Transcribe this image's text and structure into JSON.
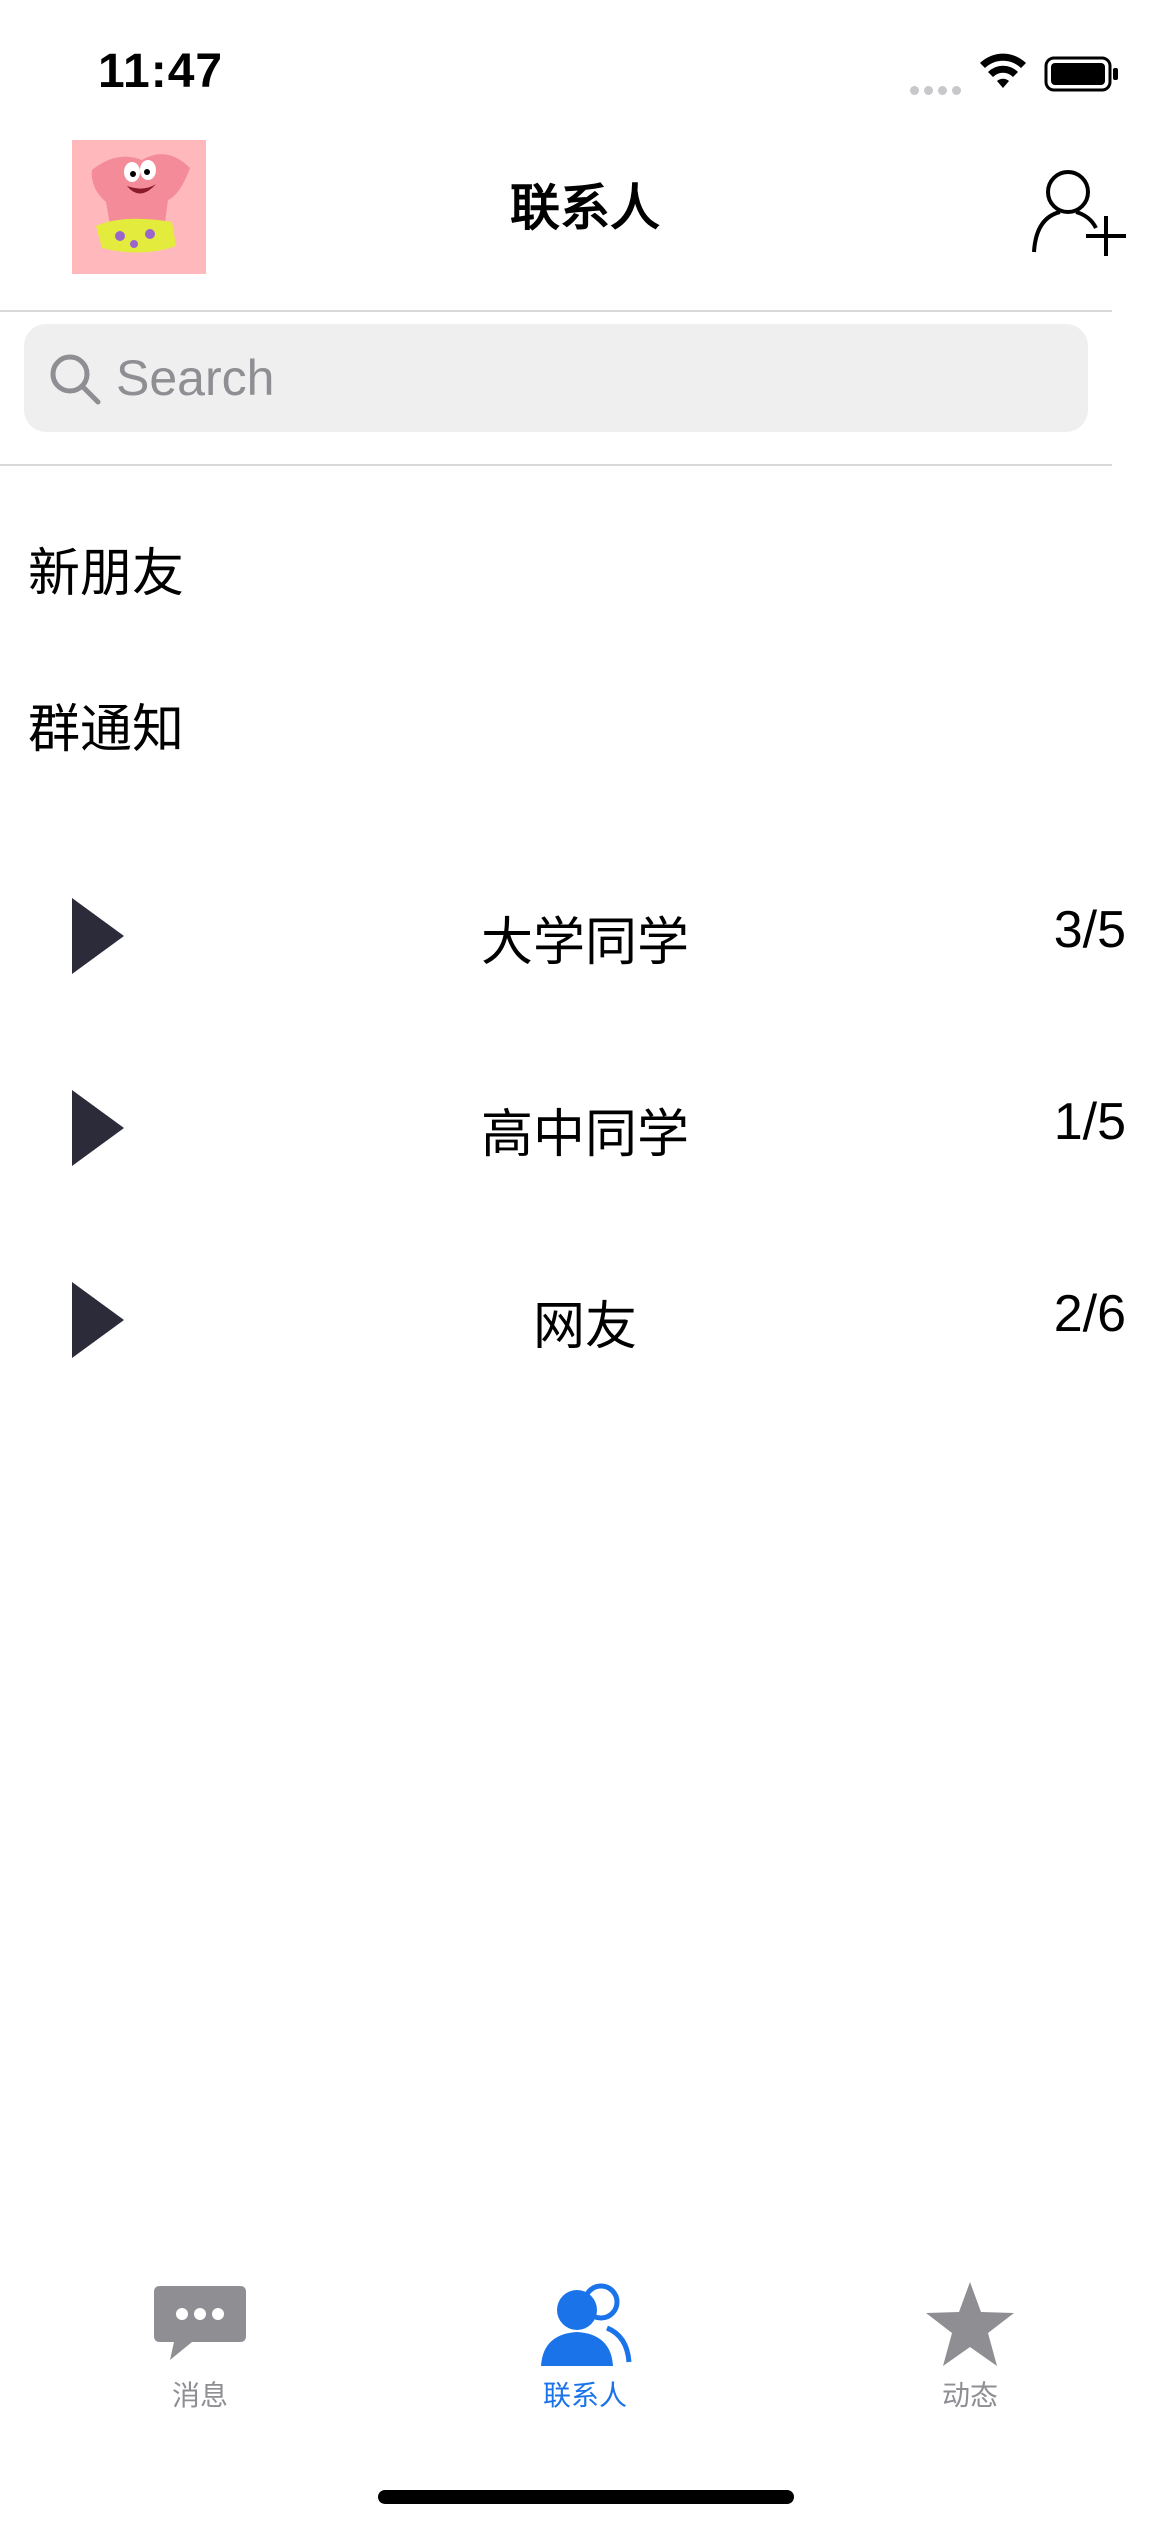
{
  "status_bar": {
    "time": "11:47"
  },
  "nav": {
    "title": "联系人"
  },
  "search": {
    "placeholder": "Search"
  },
  "menu": {
    "new_friends": "新朋友",
    "group_notice": "群通知"
  },
  "groups": [
    {
      "name": "大学同学",
      "count": "3/5"
    },
    {
      "name": "高中同学",
      "count": "1/5"
    },
    {
      "name": "网友",
      "count": "2/6"
    }
  ],
  "tabs": [
    {
      "label": "消息",
      "icon": "chat-bubble-icon",
      "active": false
    },
    {
      "label": "联系人",
      "icon": "contacts-icon",
      "active": true
    },
    {
      "label": "动态",
      "icon": "star-icon",
      "active": false
    }
  ],
  "colors": {
    "accent": "#1a73e8",
    "inactive": "#8e8e93",
    "arrow": "#2b2b3a"
  }
}
